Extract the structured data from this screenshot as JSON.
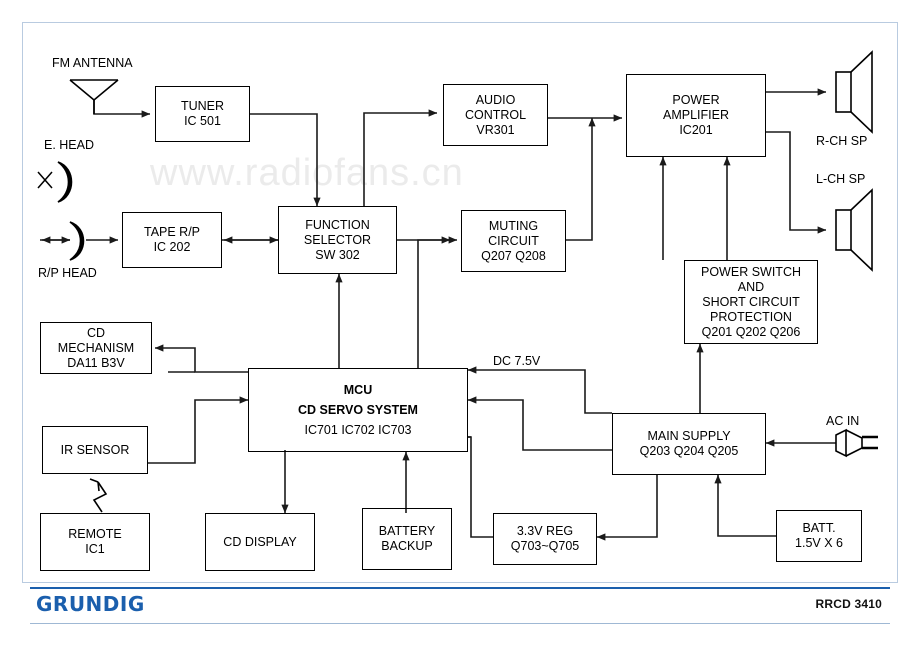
{
  "footer": {
    "brand": "GRUNDIG",
    "model": "RRCD 3410"
  },
  "watermark": "www.radiofans.cn",
  "labels": {
    "fm_antenna": "FM ANTENNA",
    "e_head": "E. HEAD",
    "rp_head": "R/P HEAD",
    "r_ch_sp": "R-CH SP",
    "l_ch_sp": "L-CH SP",
    "ac_in": "AC IN",
    "dc_75v": "DC 7.5V"
  },
  "blocks": {
    "tuner": {
      "lines": [
        "TUNER",
        "IC 501"
      ]
    },
    "tape_rp": {
      "lines": [
        "TAPE R/P",
        "IC 202"
      ]
    },
    "function_sel": {
      "lines": [
        "FUNCTION",
        "SELECTOR",
        "SW 302"
      ]
    },
    "audio_control": {
      "lines": [
        "AUDIO",
        "CONTROL",
        "VR301"
      ]
    },
    "muting": {
      "lines": [
        "MUTING",
        "CIRCUIT",
        "Q207    Q208"
      ]
    },
    "power_amp": {
      "lines": [
        "POWER",
        "AMPLIFIER",
        "IC201"
      ]
    },
    "power_switch": {
      "lines": [
        "POWER SWITCH",
        "AND",
        "SHORT CIRCUIT",
        "PROTECTION",
        "Q201   Q202   Q206"
      ]
    },
    "cd_mech": {
      "lines": [
        "CD",
        "MECHANISM",
        "DA11 B3V"
      ]
    },
    "ir_sensor": {
      "lines": [
        "IR SENSOR"
      ]
    },
    "remote": {
      "lines": [
        "REMOTE",
        "IC1"
      ]
    },
    "mcu": {
      "lines": [
        "MCU",
        "CD SERVO SYSTEM",
        "IC701    IC702    IC703"
      ]
    },
    "cd_display": {
      "lines": [
        "CD    DISPLAY"
      ]
    },
    "battery_backup": {
      "lines": [
        "BATTERY",
        "BACKUP"
      ]
    },
    "reg_33v": {
      "lines": [
        "3.3V REG",
        "Q703~Q705"
      ]
    },
    "main_supply": {
      "lines": [
        "MAIN SUPPLY",
        "Q203   Q204   Q205"
      ]
    },
    "batt": {
      "lines": [
        "BATT.",
        "1.5V X 6"
      ]
    }
  },
  "colors": {
    "brand_blue": "#1b5fad",
    "frame_blue": "#b9cbe0",
    "wire": "#1a1a1a",
    "watermark_gray": "#ebebeb"
  }
}
